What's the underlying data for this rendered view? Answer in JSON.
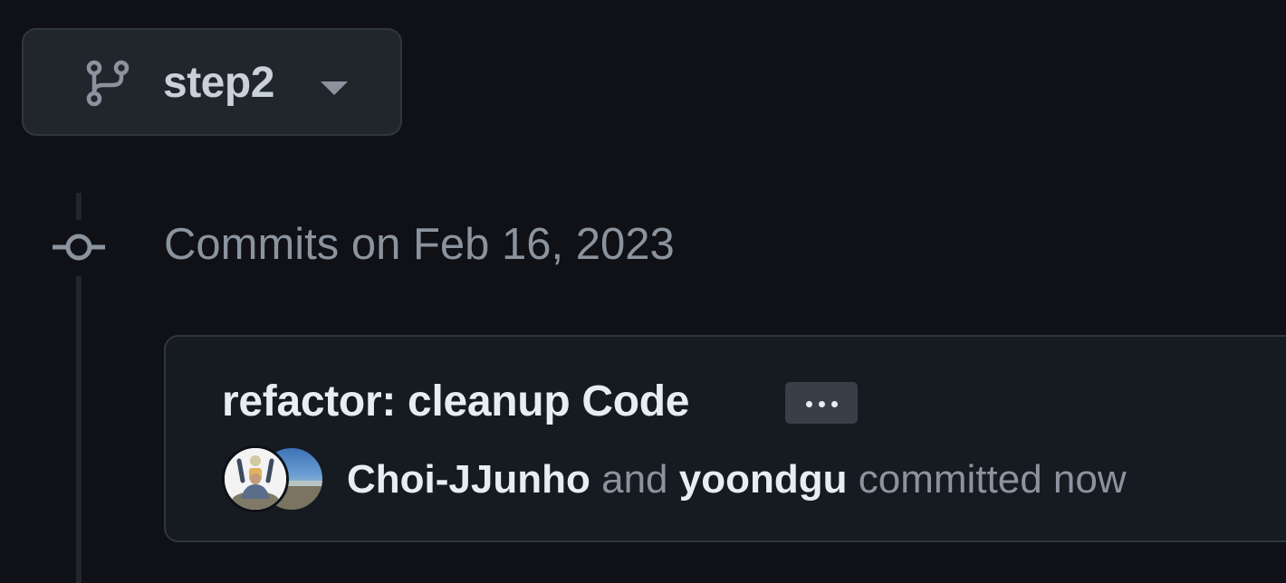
{
  "branch_selector": {
    "label": "step2",
    "icon": "git-branch-icon",
    "caret_icon": "triangle-down-icon"
  },
  "timeline": {
    "heading": "Commits on Feb 16, 2023",
    "node_icon": "git-commit-icon"
  },
  "commit": {
    "title": "refactor: cleanup Code",
    "more_button_label": "…",
    "authors": [
      {
        "name": "Choi-JJunho"
      },
      {
        "name": "yoondgu"
      }
    ],
    "connector": "and",
    "suffix": "committed now"
  },
  "colors": {
    "background": "#0f1116",
    "card_background": "#161a21",
    "button_background": "#21262d",
    "border": "#30363d",
    "muted_text": "#8b949e",
    "primary_text": "#e6edf3"
  }
}
